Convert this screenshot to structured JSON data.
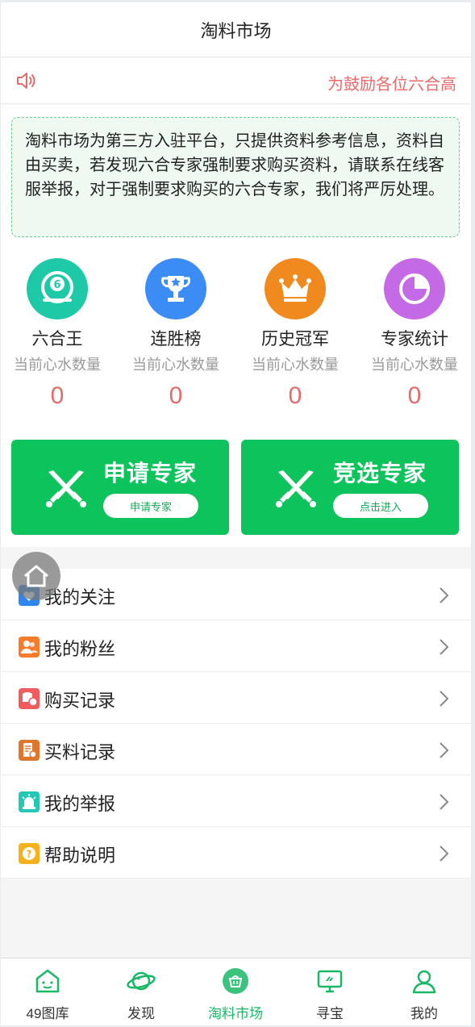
{
  "header": {
    "title": "淘料市场"
  },
  "notice": {
    "icon": "speaker-icon",
    "text": "为鼓励各位六合高"
  },
  "disclaimer": {
    "text": "淘料市场为第三方入驻平台，只提供资料参考信息，资料自由买卖，若发现六合专家强制要求购买资料，请联系在线客服举报，对于强制要求购买的六合专家，我们将严厉处理。"
  },
  "stats": [
    {
      "name": "六合王",
      "sub": "当前心水数量",
      "count": "0",
      "icon": "ball-icon",
      "color": "#1ec9a8"
    },
    {
      "name": "连胜榜",
      "sub": "当前心水数量",
      "count": "0",
      "icon": "trophy-icon",
      "color": "#3b8cf5"
    },
    {
      "name": "历史冠军",
      "sub": "当前心水数量",
      "count": "0",
      "icon": "crown-icon",
      "color": "#f08a1e"
    },
    {
      "name": "专家统计",
      "sub": "当前心水数量",
      "count": "0",
      "icon": "pie-chart-icon",
      "color": "#c56ae6"
    }
  ],
  "cta": [
    {
      "title": "申请专家",
      "button": "申请专家"
    },
    {
      "title": "竞选专家",
      "button": "点击进入"
    }
  ],
  "menu": [
    {
      "label": "我的关注",
      "icon": "heart-icon",
      "color": "#2f86f0"
    },
    {
      "label": "我的粉丝",
      "icon": "fans-icon",
      "color": "#f57c2a"
    },
    {
      "label": "购买记录",
      "icon": "coins-icon",
      "color": "#f25c5c"
    },
    {
      "label": "买料记录",
      "icon": "document-icon",
      "color": "#e0762a"
    },
    {
      "label": "我的举报",
      "icon": "alarm-icon",
      "color": "#23c8b6"
    },
    {
      "label": "帮助说明",
      "icon": "help-icon",
      "color": "#f5b21d"
    }
  ],
  "tabs": [
    {
      "label": "49图库",
      "icon": "gallery-icon"
    },
    {
      "label": "发现",
      "icon": "planet-icon"
    },
    {
      "label": "淘料市场",
      "icon": "basket-icon",
      "active": true
    },
    {
      "label": "寻宝",
      "icon": "monitor-icon"
    },
    {
      "label": "我的",
      "icon": "user-icon"
    }
  ],
  "colors": {
    "accent": "#0dc45c",
    "danger": "#e46b6b",
    "active_tab": "#19b866"
  }
}
